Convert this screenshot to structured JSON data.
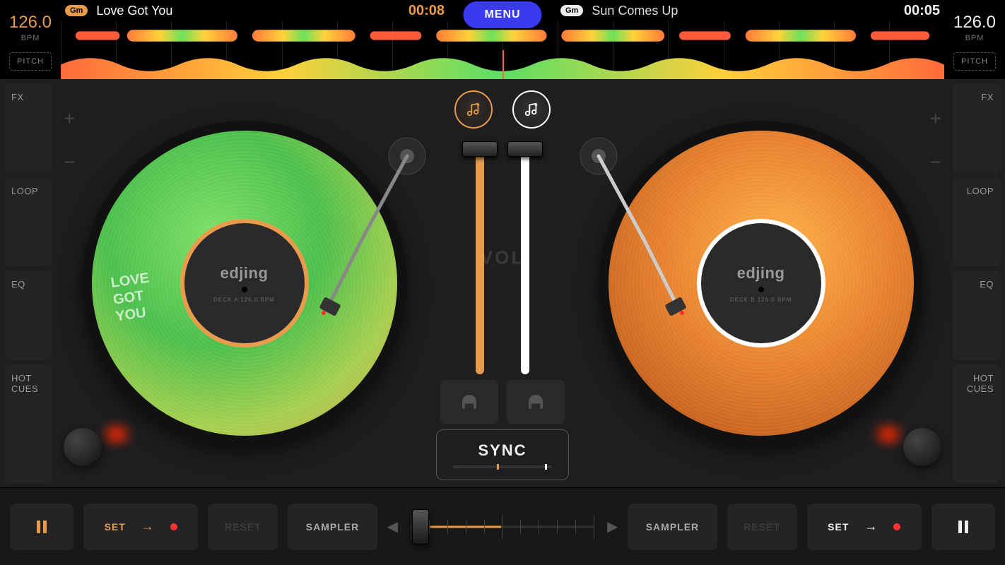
{
  "menu_label": "MENU",
  "deck_a": {
    "bpm": "126.0",
    "bpm_label": "BPM",
    "pitch": "PITCH",
    "key": "Gm",
    "title": "Love Got You",
    "time": "00:08",
    "label_brand": "edjing",
    "label_sub": "DECK A  126.0  BPM",
    "vinyl_text": "LOVE\nGOT\nYOU"
  },
  "deck_b": {
    "bpm": "126.0",
    "bpm_label": "BPM",
    "pitch": "PITCH",
    "key": "Gm",
    "title": "Sun Comes Up",
    "time": "00:05",
    "label_brand": "edjing",
    "label_sub": "DECK B  126.0  BPM"
  },
  "side_buttons": {
    "fx": "FX",
    "loop": "LOOP",
    "eq": "EQ",
    "hotcues": "HOT\nCUES"
  },
  "center": {
    "vol": "VOL",
    "sync": "SYNC"
  },
  "bottom": {
    "set": "SET",
    "reset": "RESET",
    "sampler": "SAMPLER"
  }
}
